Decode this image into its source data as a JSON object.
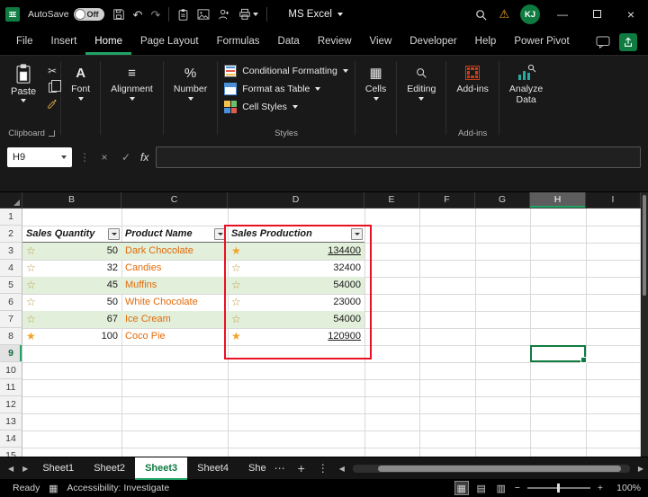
{
  "titlebar": {
    "autosave_label": "AutoSave",
    "autosave_state": "Off",
    "app_title": "MS Excel",
    "avatar_initials": "KJ"
  },
  "menu": {
    "tabs": [
      "File",
      "Insert",
      "Home",
      "Page Layout",
      "Formulas",
      "Data",
      "Review",
      "View",
      "Developer",
      "Help",
      "Power Pivot"
    ],
    "active_tab": "Home"
  },
  "ribbon": {
    "paste_label": "Paste",
    "font_label": "Font",
    "alignment_label": "Alignment",
    "number_label": "Number",
    "conditional_formatting_label": "Conditional Formatting",
    "format_as_table_label": "Format as Table",
    "cell_styles_label": "Cell Styles",
    "cells_label": "Cells",
    "editing_label": "Editing",
    "addins_label": "Add-ins",
    "analyze_line1": "Analyze",
    "analyze_line2": "Data",
    "group_labels": {
      "clipboard": "Clipboard",
      "styles": "Styles",
      "addins": "Add-ins"
    }
  },
  "formula_bar": {
    "name_box_value": "H9",
    "fx_label": "fx"
  },
  "grid": {
    "columns": [
      "B",
      "C",
      "D",
      "E",
      "F",
      "G",
      "H",
      "I"
    ],
    "rows": [
      "1",
      "2",
      "3",
      "4",
      "5",
      "6",
      "7",
      "8",
      "9",
      "10",
      "11",
      "12",
      "13",
      "14",
      "15"
    ],
    "selected_cell": "H9",
    "selected_column": "H",
    "selected_row": "9"
  },
  "table": {
    "headers": [
      "Sales Quantity",
      "Product Name",
      "Sales Production"
    ],
    "rows": [
      {
        "quantity": "50",
        "quantity_star": "☆",
        "quantity_star_state": "empty",
        "product": "Dark Chocolate",
        "production": "134400",
        "production_star": "★",
        "production_star_state": "full"
      },
      {
        "quantity": "32",
        "quantity_star": "☆",
        "quantity_star_state": "empty",
        "product": "Candies",
        "production": "32400",
        "production_star": "☆",
        "production_star_state": "empty"
      },
      {
        "quantity": "45",
        "quantity_star": "☆",
        "quantity_star_state": "empty",
        "product": "Muffins",
        "production": "54000",
        "production_star": "☆",
        "production_star_state": "empty"
      },
      {
        "quantity": "50",
        "quantity_star": "☆",
        "quantity_star_state": "empty",
        "product": "White Chocolate",
        "production": "23000",
        "production_star": "☆",
        "production_star_state": "empty"
      },
      {
        "quantity": "67",
        "quantity_star": "☆",
        "quantity_star_state": "empty",
        "product": "Ice Cream",
        "production": "54000",
        "production_star": "☆",
        "production_star_state": "empty"
      },
      {
        "quantity": "100",
        "quantity_star": "★",
        "quantity_star_state": "full",
        "product": "Coco Pie",
        "production": "120900",
        "production_star": "★",
        "production_star_state": "full"
      }
    ]
  },
  "sheet_tabs": {
    "tabs": [
      "Sheet1",
      "Sheet2",
      "Sheet3",
      "Sheet4",
      "She"
    ],
    "active_tab": "Sheet3"
  },
  "status_bar": {
    "mode": "Ready",
    "accessibility": "Accessibility: Investigate",
    "zoom_level": "100%"
  },
  "icons": {
    "undo": "↶",
    "redo": "↷",
    "cut": "✂",
    "warning": "⚠",
    "minimize": "—",
    "close": "×",
    "font": "A",
    "alignment": "≡",
    "number": "%",
    "cells": "▦",
    "check": "✓",
    "x": "×",
    "ellipsis": "⋯",
    "add_sheet": "+",
    "kebab": "⋮",
    "scroll_left": "◀",
    "scroll_right": "▶",
    "normal_view": "▦",
    "page_layout": "▤",
    "page_break": "▥",
    "accessibility": "▦",
    "zoom_minus": "−",
    "zoom_plus": "+"
  },
  "colors": {
    "accent_green": "#21a366",
    "selection_green": "#107c41",
    "highlight_red": "#e81123",
    "banded_row_green": "#e2efda",
    "product_text_orange": "#e26b0a",
    "star_gold": "#f0a32a",
    "warning_orange": "#f0a029"
  }
}
